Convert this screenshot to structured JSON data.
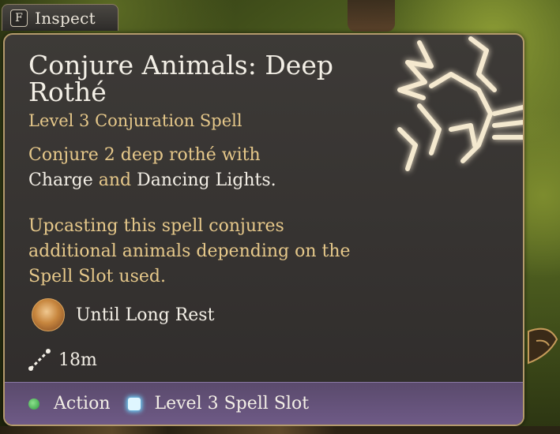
{
  "inspect": {
    "key": "F",
    "label": "Inspect"
  },
  "spell": {
    "title": "Conjure Animals: Deep Rothé",
    "subtitle": "Level 3 Conjuration Spell",
    "description": {
      "prefix": "Conjure 2 deep rothé with ",
      "link1": "Charge",
      "middle": " and ",
      "link2": "Dancing Lights",
      "suffix": "."
    },
    "upcast": "Upcasting this spell conjures additional animals depending on the Spell Slot used.",
    "duration": {
      "icon": "duration-icon",
      "text": "Until Long Rest"
    },
    "range": {
      "icon": "range-icon",
      "text": "18m"
    }
  },
  "footer": {
    "action_label": "Action",
    "slot_label": "Level 3 Spell Slot"
  },
  "colors": {
    "accent_gold": "#e6c88a",
    "text_light": "#f3efe6",
    "footer_purple": "#6e5a86",
    "action_green": "#3fb04c",
    "slot_cyan": "#6fd6ff"
  }
}
